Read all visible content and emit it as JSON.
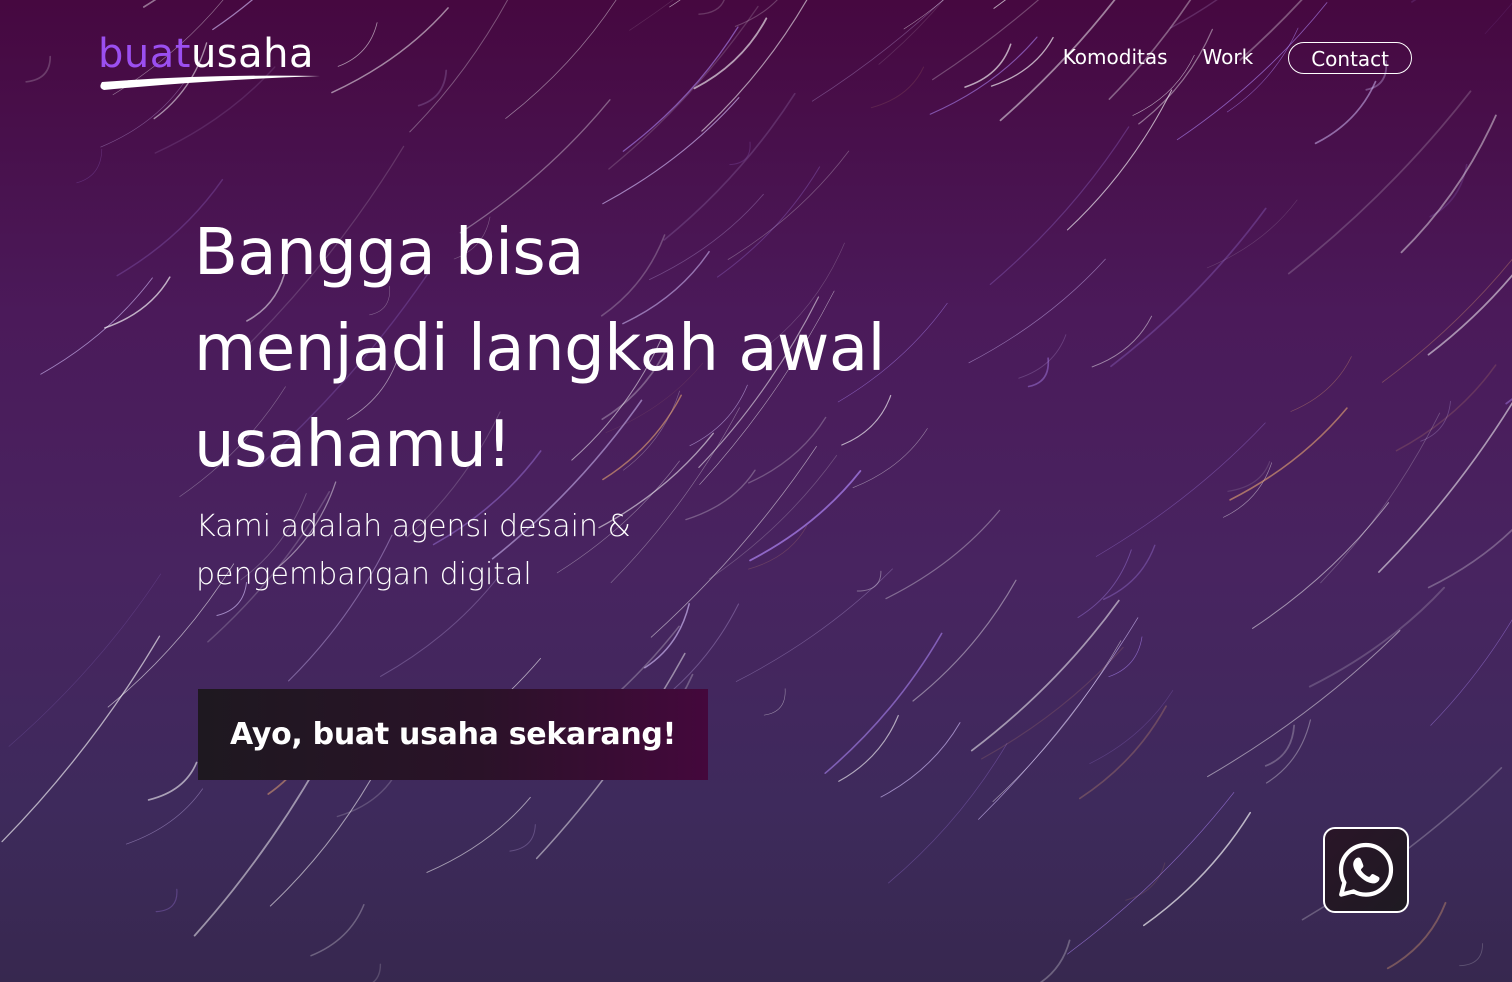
{
  "header": {
    "logo": {
      "part1": "buat",
      "part2": "usaha",
      "brand_color": "#9b4ff0"
    },
    "nav": {
      "items": [
        {
          "label": "Komoditas"
        },
        {
          "label": "Work"
        }
      ],
      "contact_label": "Contact"
    }
  },
  "hero": {
    "heading_lines": [
      "Bangga bisa",
      "menjadi langkah awal",
      "usahamu!"
    ],
    "subtitle_lines": [
      "Kami adalah agensi desain &",
      "pengembangan digital"
    ],
    "cta_label": "Ayo, buat usaha sekarang!"
  },
  "floating": {
    "whatsapp_icon": "whatsapp-icon"
  },
  "colors": {
    "background_top": "#460840",
    "background_bottom": "#37284f",
    "accent": "#9b4ff0",
    "cta_background": "#1e1820"
  }
}
